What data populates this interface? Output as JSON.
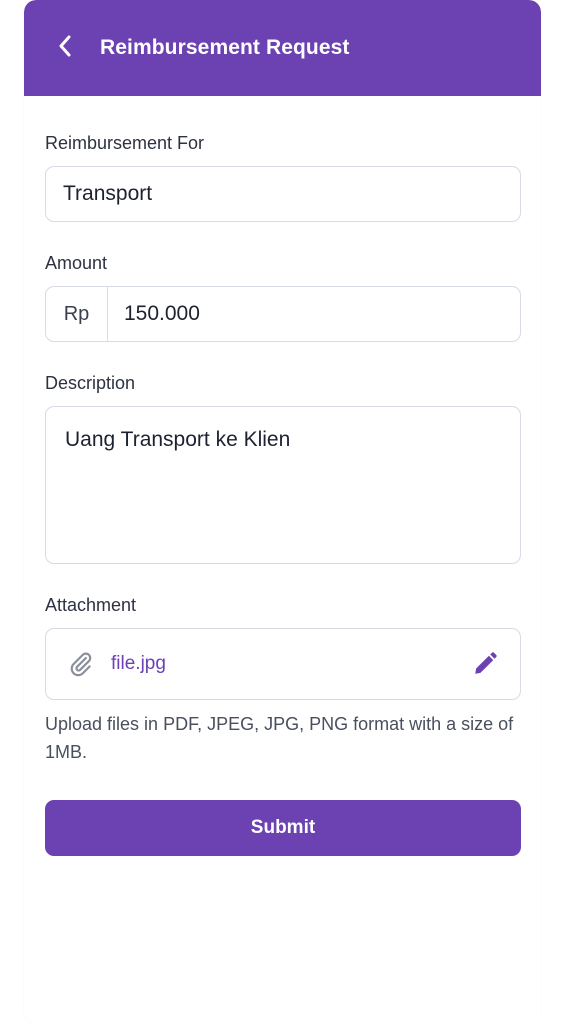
{
  "header": {
    "title": "Reimbursement Request"
  },
  "form": {
    "reimbursement_for": {
      "label": "Reimbursement For",
      "value": "Transport"
    },
    "amount": {
      "label": "Amount",
      "prefix": "Rp",
      "value": "150.000"
    },
    "description": {
      "label": "Description",
      "value": "Uang Transport ke Klien"
    },
    "attachment": {
      "label": "Attachment",
      "file_name": "file.jpg",
      "helper": "Upload files in PDF, JPEG, JPG, PNG format with a size of 1MB.",
      "icons": [
        "paperclip-icon",
        "pencil-icon"
      ]
    },
    "submit_label": "Submit"
  },
  "colors": {
    "primary": "#6C42B3",
    "border": "#d7dbe3",
    "text": "#1e2230",
    "label": "#2d3142"
  }
}
